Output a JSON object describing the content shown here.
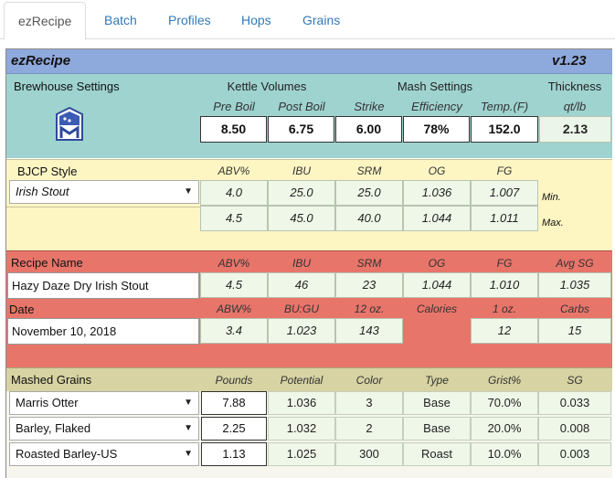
{
  "tabs": [
    {
      "label": "ezRecipe",
      "active": true
    },
    {
      "label": "Batch"
    },
    {
      "label": "Profiles"
    },
    {
      "label": "Hops"
    },
    {
      "label": "Grains"
    }
  ],
  "header": {
    "title": "ezRecipe",
    "version": "v1.23"
  },
  "brewhouse": {
    "label": "Brewhouse Settings",
    "kettle_label": "Kettle Volumes",
    "mash_label": "Mash Settings",
    "thickness_label": "Thickness",
    "col_pre_boil": "Pre Boil",
    "col_post_boil": "Post Boil",
    "col_strike": "Strike",
    "col_efficiency": "Efficiency",
    "col_temp": "Temp.(F)",
    "col_thickness_unit": "qt/lb",
    "pre_boil": "8.50",
    "post_boil": "6.75",
    "strike": "6.00",
    "efficiency": "78%",
    "temp": "152.0",
    "thickness": "2.13"
  },
  "bjcp": {
    "label": "BJCP Style",
    "col_abv": "ABV%",
    "col_ibu": "IBU",
    "col_srm": "SRM",
    "col_og": "OG",
    "col_fg": "FG",
    "style": "Irish Stout",
    "min": {
      "abv": "4.0",
      "ibu": "25.0",
      "srm": "25.0",
      "og": "1.036",
      "fg": "1.007",
      "label": "Min."
    },
    "max": {
      "abv": "4.5",
      "ibu": "45.0",
      "srm": "40.0",
      "og": "1.044",
      "fg": "1.011",
      "label": "Max."
    }
  },
  "recipe": {
    "name_label": "Recipe Name",
    "col_abv": "ABV%",
    "col_ibu": "IBU",
    "col_srm": "SRM",
    "col_og": "OG",
    "col_fg": "FG",
    "col_avg_sg": "Avg SG",
    "name": "Hazy Daze Dry Irish Stout",
    "abv": "4.5",
    "ibu": "46",
    "srm": "23",
    "og": "1.044",
    "fg": "1.010",
    "avg_sg": "1.035",
    "date_label": "Date",
    "col_abw": "ABW%",
    "col_bugu": "BU:GU",
    "col_12oz": "12 oz.",
    "col_calories": "Calories",
    "col_1oz": "1 oz.",
    "col_carbs": "Carbs",
    "date": "November 10, 2018",
    "abw": "3.4",
    "bugu": "1.023",
    "cal_12oz": "143",
    "cal_1oz": "12",
    "carbs": "15"
  },
  "grains": {
    "label": "Mashed Grains",
    "col_pounds": "Pounds",
    "col_potential": "Potential",
    "col_color": "Color",
    "col_type": "Type",
    "col_grist": "Grist%",
    "col_sg": "SG",
    "rows": [
      {
        "name": "Marris Otter",
        "pounds": "7.88",
        "potential": "1.036",
        "color": "3",
        "type": "Base",
        "grist": "70.0%",
        "sg": "0.033"
      },
      {
        "name": "Barley, Flaked",
        "pounds": "2.25",
        "potential": "1.032",
        "color": "2",
        "type": "Base",
        "grist": "20.0%",
        "sg": "0.008"
      },
      {
        "name": "Roasted Barley-US",
        "pounds": "1.13",
        "potential": "1.025",
        "color": "300",
        "type": "Roast",
        "grist": "10.0%",
        "sg": "0.003"
      }
    ]
  },
  "colors": {
    "header": "#8ea9db",
    "brewhouse": "#9fd3cf",
    "bjcp": "#fdf6c3",
    "recipe": "#e8756a",
    "grains_header": "#d7d3a2",
    "cell": "#eef7e8"
  }
}
